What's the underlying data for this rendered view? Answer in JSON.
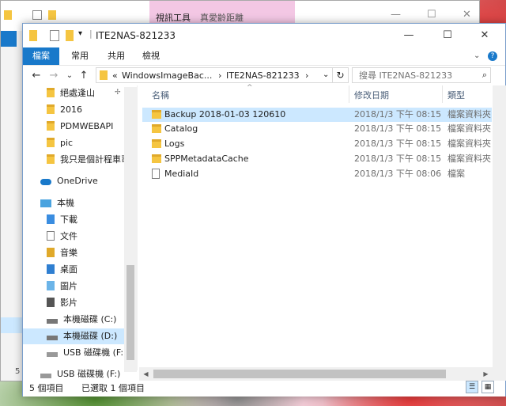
{
  "back_window": {
    "context_tab": "視訊工具",
    "title": "真愛齡距離",
    "status_fragment": "5"
  },
  "window": {
    "title": "ITE2NAS-821233",
    "controls": {
      "minimize": "—",
      "maximize": "☐",
      "close": "✕"
    }
  },
  "ribbon": {
    "tabs": [
      "檔案",
      "常用",
      "共用",
      "檢視"
    ],
    "expand_icon": "⌄",
    "help_icon": "?"
  },
  "address": {
    "back": "←",
    "forward": "→",
    "recent": "⌄",
    "up": "↑",
    "prefix": "«",
    "crumbs": [
      "WindowsImageBac...",
      "ITE2NAS-821233"
    ],
    "separator": "›",
    "dropdown": "⌄",
    "refresh": "↻"
  },
  "search": {
    "placeholder": "搜尋 ITE2NAS-821233",
    "icon": "⌕"
  },
  "nav": {
    "quick": [
      "絕處逢山",
      "2016",
      "PDMWEBAPI",
      "pic",
      "我只是個計程車司"
    ],
    "onedrive": "OneDrive",
    "thispc": "本機",
    "pc_items": [
      "下載",
      "文件",
      "音樂",
      "桌面",
      "圖片",
      "影片"
    ],
    "drives": [
      "本機磁碟 (C:)",
      "本機磁碟 (D:)",
      "USB 磁碟機 (F:)"
    ],
    "usb_root": "USB 磁碟機 (F:)"
  },
  "columns": {
    "name": "名稱",
    "date": "修改日期",
    "type": "類型",
    "sort_arrow": "^"
  },
  "files": [
    {
      "name": "Backup 2018-01-03 120610",
      "date": "2018/1/3 下午 08:15",
      "type": "檔案資料夾",
      "kind": "folder"
    },
    {
      "name": "Catalog",
      "date": "2018/1/3 下午 08:15",
      "type": "檔案資料夾",
      "kind": "folder"
    },
    {
      "name": "Logs",
      "date": "2018/1/3 下午 08:15",
      "type": "檔案資料夾",
      "kind": "folder"
    },
    {
      "name": "SPPMetadataCache",
      "date": "2018/1/3 下午 08:15",
      "type": "檔案資料夾",
      "kind": "folder"
    },
    {
      "name": "MediaId",
      "date": "2018/1/3 下午 08:06",
      "type": "檔案",
      "kind": "file"
    }
  ],
  "status": {
    "count": "5 個項目",
    "selected": "已選取 1 個項目"
  },
  "colors": {
    "accent": "#1979ca",
    "selection": "#cce8ff",
    "folder": "#f5c541"
  }
}
